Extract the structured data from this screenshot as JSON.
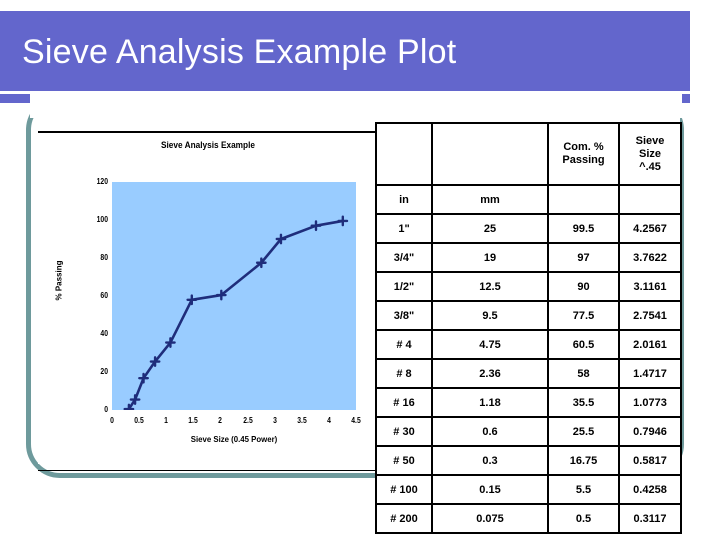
{
  "slide": {
    "title": "Sieve Analysis Example Plot",
    "title_bg": "#6366CC",
    "frame_color": "#6E9A9C"
  },
  "chart_data": {
    "type": "line",
    "title": "Sieve Analysis Example",
    "xlabel": "Sieve Size (0.45 Power)",
    "ylabel": "% Passing",
    "xlim": [
      0,
      4.5
    ],
    "ylim": [
      0,
      120
    ],
    "xticks": [
      "0",
      "0.5",
      "1",
      "1.5",
      "2",
      "2.5",
      "3",
      "3.5",
      "4",
      "4.5"
    ],
    "yticks": [
      "120",
      "100",
      "80",
      "60",
      "40",
      "20",
      "0"
    ],
    "grid": false,
    "legend": "none",
    "plot_bg": "#99CCFF",
    "line_color": "#1F2D7B",
    "marker": "cross",
    "x": [
      0.3117,
      0.4258,
      0.5817,
      0.7946,
      1.0773,
      1.4717,
      2.0161,
      2.7541,
      3.1161,
      3.7622,
      4.2567
    ],
    "y": [
      0.5,
      5.5,
      16.75,
      25.5,
      35.5,
      58,
      60.5,
      77.5,
      90,
      97,
      99.5
    ]
  },
  "table": {
    "headers": {
      "col0": "",
      "col1": "",
      "col2": "Com. % Passing",
      "col2_line1": "Com. %",
      "col2_line2": "Passing",
      "col3_line1": "Sieve",
      "col3_line2": "Size",
      "col3_line3": "^.45"
    },
    "units": {
      "col0": "in",
      "col1": "mm",
      "col2": "",
      "col3": ""
    },
    "rows": [
      {
        "sieve_in": "1\"",
        "size_mm": "25",
        "pct_passing": "99.5",
        "size_45": "4.2567"
      },
      {
        "sieve_in": "3/4\"",
        "size_mm": "19",
        "pct_passing": "97",
        "size_45": "3.7622"
      },
      {
        "sieve_in": "1/2\"",
        "size_mm": "12.5",
        "pct_passing": "90",
        "size_45": "3.1161"
      },
      {
        "sieve_in": "3/8\"",
        "size_mm": "9.5",
        "pct_passing": "77.5",
        "size_45": "2.7541"
      },
      {
        "sieve_in": "# 4",
        "size_mm": "4.75",
        "pct_passing": "60.5",
        "size_45": "2.0161"
      },
      {
        "sieve_in": "# 8",
        "size_mm": "2.36",
        "pct_passing": "58",
        "size_45": "1.4717"
      },
      {
        "sieve_in": "# 16",
        "size_mm": "1.18",
        "pct_passing": "35.5",
        "size_45": "1.0773"
      },
      {
        "sieve_in": "# 30",
        "size_mm": "0.6",
        "pct_passing": "25.5",
        "size_45": "0.7946"
      },
      {
        "sieve_in": "# 50",
        "size_mm": "0.3",
        "pct_passing": "16.75",
        "size_45": "0.5817"
      },
      {
        "sieve_in": "# 100",
        "size_mm": "0.15",
        "pct_passing": "5.5",
        "size_45": "0.4258"
      },
      {
        "sieve_in": "# 200",
        "size_mm": "0.075",
        "pct_passing": "0.5",
        "size_45": "0.3117"
      }
    ]
  }
}
